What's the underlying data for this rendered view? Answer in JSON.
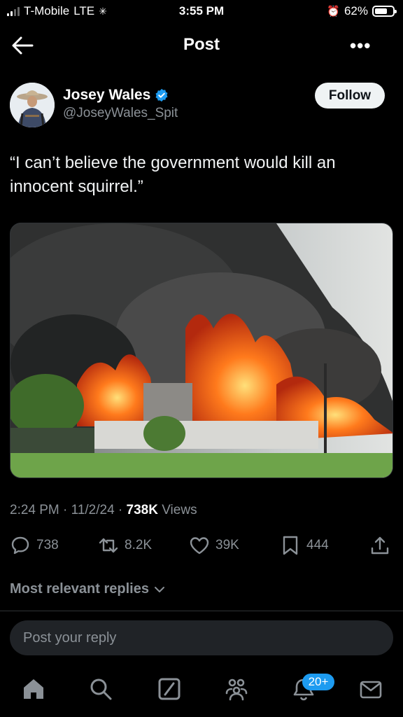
{
  "status_bar": {
    "carrier": "T-Mobile",
    "network": "LTE",
    "time": "3:55 PM",
    "battery": "62%"
  },
  "header": {
    "title": "Post",
    "more_label": "•••",
    "back_icon": "arrow-left-icon"
  },
  "author": {
    "name": "Josey Wales",
    "handle": "@JoseyWales_Spit",
    "follow_label": "Follow",
    "verified_color": "#1d9bf0"
  },
  "tweet": {
    "text": "“I can’t believe the government would kill an innocent squirrel.”",
    "media_icon": "burning-building-photo"
  },
  "meta": {
    "time": "2:24 PM",
    "sep1": " · ",
    "date": "11/2/24",
    "sep2": " · ",
    "views_count": "738K",
    "views_label": " Views"
  },
  "actions": {
    "replies": "738",
    "reposts": "8.2K",
    "likes": "39K",
    "bookmarks": "444"
  },
  "replies_filter": {
    "label": "Most relevant replies"
  },
  "reply_box": {
    "placeholder": "Post your reply"
  },
  "tabbar": {
    "notifications_badge": "20+",
    "accent": "#1d9bf0"
  }
}
